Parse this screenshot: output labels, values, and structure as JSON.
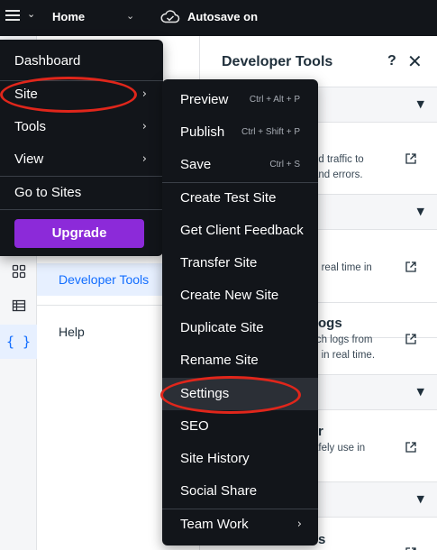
{
  "topbar": {
    "menu_icon": "hamburger-icon",
    "page_name": "Home",
    "autosave": "Autosave on"
  },
  "panel2": {
    "developer_tools": "Developer Tools",
    "help": "Help"
  },
  "devpanel": {
    "title": "Developer Tools",
    "help_glyph": "?",
    "close_glyph": "✕",
    "fragments": {
      "f1a": "nd traffic to",
      "f1b": "and errors.",
      "f2a": "n real time in",
      "f3h": "ogs",
      "f3a": "rch logs from",
      "f3b": "d in real time.",
      "f4h": "r",
      "f4a": "afely use in",
      "f5h": "s"
    }
  },
  "main_menu": {
    "items": [
      {
        "label": "Dashboard"
      },
      {
        "label": "Site",
        "has_submenu": true
      },
      {
        "label": "Tools",
        "has_submenu": true
      },
      {
        "label": "View",
        "has_submenu": true
      },
      {
        "label": "Go to Sites"
      }
    ],
    "upgrade": "Upgrade",
    "arrow": "›"
  },
  "site_submenu": {
    "items": [
      {
        "label": "Preview",
        "shortcut": "Ctrl + Alt + P"
      },
      {
        "label": "Publish",
        "shortcut": "Ctrl + Shift + P"
      },
      {
        "label": "Save",
        "shortcut": "Ctrl + S"
      },
      {
        "label": "Create Test Site"
      },
      {
        "label": "Get Client Feedback"
      },
      {
        "label": "Transfer Site"
      },
      {
        "label": "Create New Site"
      },
      {
        "label": "Duplicate Site"
      },
      {
        "label": "Rename Site"
      },
      {
        "label": "Settings"
      },
      {
        "label": "SEO"
      },
      {
        "label": "Site History"
      },
      {
        "label": "Social Share"
      },
      {
        "label": "Team Work",
        "has_submenu": true
      }
    ],
    "arrow": "›"
  },
  "colors": {
    "menu_bg": "#12151a",
    "upgrade": "#8c2ad9",
    "accent": "#116dff",
    "highlight_oval": "#e0261b"
  }
}
